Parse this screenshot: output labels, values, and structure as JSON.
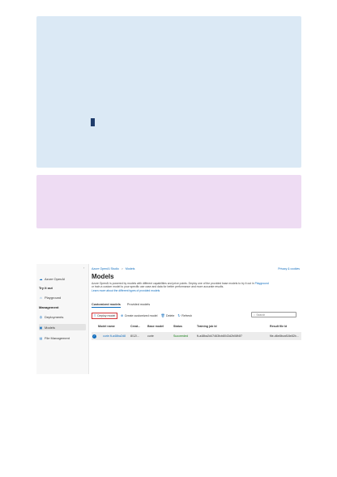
{
  "sidebar": {
    "items": [
      {
        "label": "Azure OpenAI",
        "icon": "cloud-icon"
      },
      {
        "label": "Try it out",
        "icon": ""
      },
      {
        "label": "Playground",
        "icon": "playground-icon"
      },
      {
        "label": "Management",
        "icon": ""
      },
      {
        "label": "Deployments",
        "icon": "deployments-icon"
      },
      {
        "label": "Models",
        "icon": "models-icon"
      },
      {
        "label": "File Management",
        "icon": "file-icon"
      }
    ]
  },
  "header": {
    "crumb1": "Azure OpenAI Studio",
    "crumb_sep": ">",
    "crumb2": "Models",
    "privacy": "Privacy & cookies"
  },
  "page": {
    "title": "Models",
    "desc_line1": "Azure OpenAI is powered by models with different capabilities and price points. Deploy one of the provided base models to try it out in",
    "desc_link1": "Playground",
    "desc_line2": "or train a custom model to your specific use case and data for better performance and more accurate results.",
    "desc_link2": "Learn more about the different types of provided models"
  },
  "tabs": [
    "Customized models",
    "Provided models"
  ],
  "toolbar": {
    "deploy": "Deploy model",
    "create": "Create customized model",
    "delete": "Delete",
    "refresh": "Refresh"
  },
  "search": {
    "placeholder": "Search"
  },
  "table": {
    "headers": [
      "Model name",
      "Creat...",
      "Base model",
      "Status",
      "Training job Id",
      "Result file Id"
    ],
    "row": [
      "curie.ft-a48ba2d8",
      "8/12/...",
      "curie",
      "Succeeded",
      "ft-a48ba2d47463fcb8043d2b08f4f7",
      "file-d6e8bcaf18e82b..."
    ]
  }
}
